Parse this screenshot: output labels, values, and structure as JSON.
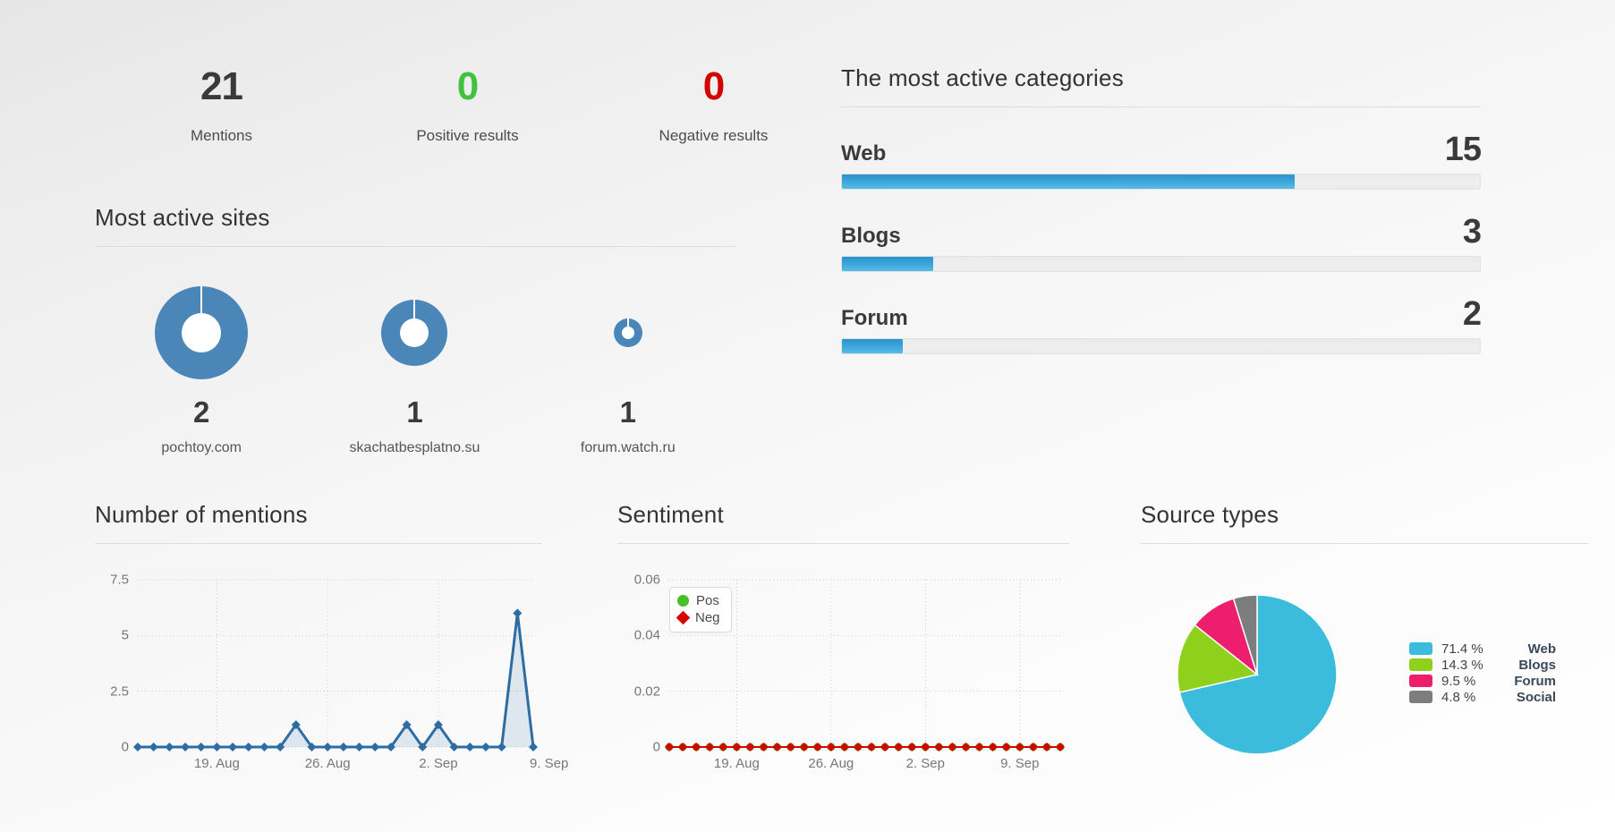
{
  "stats": [
    {
      "value": "21",
      "label": "Mentions",
      "tone": "neutral"
    },
    {
      "value": "0",
      "label": "Positive results",
      "tone": "positive"
    },
    {
      "value": "0",
      "label": "Negative results",
      "tone": "negative"
    }
  ],
  "sites_panel": {
    "title": "Most active sites",
    "items": [
      {
        "name": "pochtoy.com",
        "count": "2",
        "radius": 52,
        "hole": 22
      },
      {
        "name": "skachatbesplatno.su",
        "count": "1",
        "radius": 37,
        "hole": 16
      },
      {
        "name": "forum.watch.ru",
        "count": "1",
        "radius": 16,
        "hole": 7
      }
    ]
  },
  "categories_panel": {
    "title": "The most active categories",
    "items": [
      {
        "name": "Web",
        "value": "15",
        "percent": 71
      },
      {
        "name": "Blogs",
        "value": "3",
        "percent": 14.3
      },
      {
        "name": "Forum",
        "value": "2",
        "percent": 9.5
      }
    ]
  },
  "colors": {
    "accent_blue": "#3ba3d8",
    "positive_green": "#3fc23f",
    "negative_red": "#d40000",
    "pie_web": "#3bbcdc",
    "pie_blogs": "#8ed01c",
    "pie_forum": "#ed1e6e",
    "pie_social": "#7d7d7d",
    "track_gray": "#ececec"
  },
  "chart_data": [
    {
      "type": "line",
      "title": "Number of mentions",
      "xlabel": "",
      "ylabel": "",
      "ylim": [
        0,
        7.5
      ],
      "yticks": [
        "0",
        "2.5",
        "5",
        "7.5"
      ],
      "ytick_values": [
        0,
        2.5,
        5,
        7.5
      ],
      "xticks": [
        "19. Aug",
        "26. Aug",
        "2. Sep",
        "9. Sep"
      ],
      "xtick_indices": [
        5,
        12,
        19,
        26
      ],
      "grid": true,
      "legend": "none",
      "series": [
        {
          "name": "Mentions",
          "color": "#2e6da4",
          "marker": "diamond",
          "fill": true,
          "values": [
            0,
            0,
            0,
            0,
            0,
            0,
            0,
            0,
            0,
            0,
            1,
            0,
            0,
            0,
            0,
            0,
            0,
            1,
            0,
            1,
            0,
            0,
            0,
            0,
            6,
            0
          ]
        }
      ]
    },
    {
      "type": "line",
      "title": "Sentiment",
      "xlabel": "",
      "ylabel": "",
      "ylim": [
        0,
        0.06
      ],
      "yticks": [
        "0",
        "0.02",
        "0.04",
        "0.06"
      ],
      "ytick_values": [
        0,
        0.02,
        0.04,
        0.06
      ],
      "xticks": [
        "19. Aug",
        "26. Aug",
        "2. Sep",
        "9. Sep"
      ],
      "xtick_indices": [
        5,
        12,
        19,
        26
      ],
      "grid": true,
      "legend": "top-left",
      "series": [
        {
          "name": "Pos",
          "color": "#49c02a",
          "marker": "circle",
          "values": [
            0,
            0,
            0,
            0,
            0,
            0,
            0,
            0,
            0,
            0,
            0,
            0,
            0,
            0,
            0,
            0,
            0,
            0,
            0,
            0,
            0,
            0,
            0,
            0,
            0,
            0,
            0,
            0,
            0,
            0
          ]
        },
        {
          "name": "Neg",
          "color": "#d70000",
          "marker": "diamond",
          "values": [
            0,
            0,
            0,
            0,
            0,
            0,
            0,
            0,
            0,
            0,
            0,
            0,
            0,
            0,
            0,
            0,
            0,
            0,
            0,
            0,
            0,
            0,
            0,
            0,
            0,
            0,
            0,
            0,
            0,
            0
          ]
        }
      ]
    },
    {
      "type": "pie",
      "title": "Source types",
      "legend_position": "right",
      "slices": [
        {
          "label": "Web",
          "percent": 71.4,
          "percent_text": "71.4 %",
          "color": "#3bbcdc"
        },
        {
          "label": "Blogs",
          "percent": 14.3,
          "percent_text": "14.3 %",
          "color": "#8ed01c"
        },
        {
          "label": "Forum",
          "percent": 9.5,
          "percent_text": "9.5 %",
          "color": "#ed1e6e"
        },
        {
          "label": "Social",
          "percent": 4.8,
          "percent_text": "4.8 %",
          "color": "#7d7d7d"
        }
      ]
    }
  ]
}
